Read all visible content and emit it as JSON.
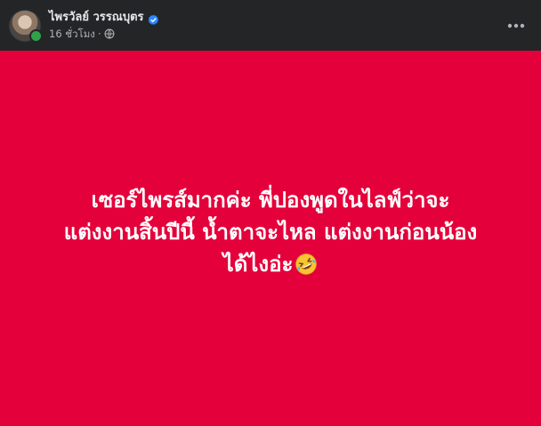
{
  "post": {
    "author_name": "ไพรวัลย์ วรรณบุตร",
    "verified": true,
    "timestamp": "16 ชั่วโมง",
    "separator": "·",
    "audience_icon": "globe-icon",
    "more_icon": "ellipsis-icon",
    "body_lines": [
      "เซอร์ไพรส์มากค่ะ พี่ปองพูดในไลฟ์ว่าจะ",
      "แต่งงานสิ้นปีนี้ น้ำตาจะไหล แต่งงานก่อนน้อง",
      "ได้ไงอ่ะ"
    ],
    "emoji": "rolling-on-floor-laughing-emoji",
    "background_color": "#e4003a",
    "text_color": "#ffffff"
  }
}
